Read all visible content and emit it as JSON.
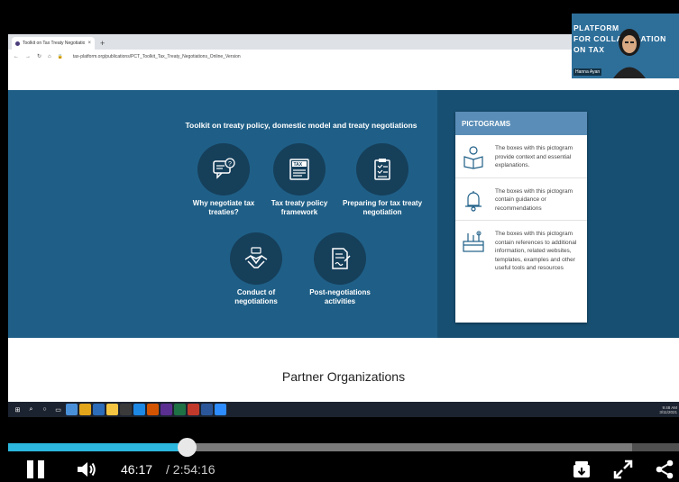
{
  "browser": {
    "tab_title": "Toolkit on Tax Treaty Negotiation",
    "tab_close": "×",
    "new_tab": "+",
    "url": "tax-platform.org/publications/PCT_Toolkit_Tax_Treaty_Negotiations_Online_Version"
  },
  "page": {
    "toolkit_title": "Toolkit on treaty policy, domestic model and treaty negotiations",
    "tools": [
      {
        "label": "Why negotiate tax treaties?"
      },
      {
        "label": "Tax treaty policy framework"
      },
      {
        "label": "Preparing for tax treaty negotiation"
      },
      {
        "label": "Conduct of negotiations"
      },
      {
        "label": "Post-negotiations activities"
      }
    ],
    "pictograms": {
      "title": "PICTOGRAMS",
      "items": [
        {
          "text": "The boxes with this pictogram provide context and essential explanations."
        },
        {
          "text": "The boxes with this pictogram contain guidance or recommendations"
        },
        {
          "text": "The boxes with this pictogram contain references to additional information, related websites, templates, examples and other useful tools and resources"
        }
      ]
    },
    "partners_title": "Partner Organizations"
  },
  "taskbar": {
    "clock_time": "9:48 AM",
    "clock_date": "3/11/2021"
  },
  "webcam": {
    "overlay_line1": "PLATFORM",
    "overlay_line2": "FOR COLLABORATION",
    "overlay_line3": "ON TAX",
    "presenter_name": "Hanna Ayan"
  },
  "player": {
    "current_time": "46:17",
    "total_time": "/ 2:54:16",
    "progress_fraction": 0.2667,
    "buffer_fraction": 0.93,
    "accent_color": "#2bb7de"
  }
}
